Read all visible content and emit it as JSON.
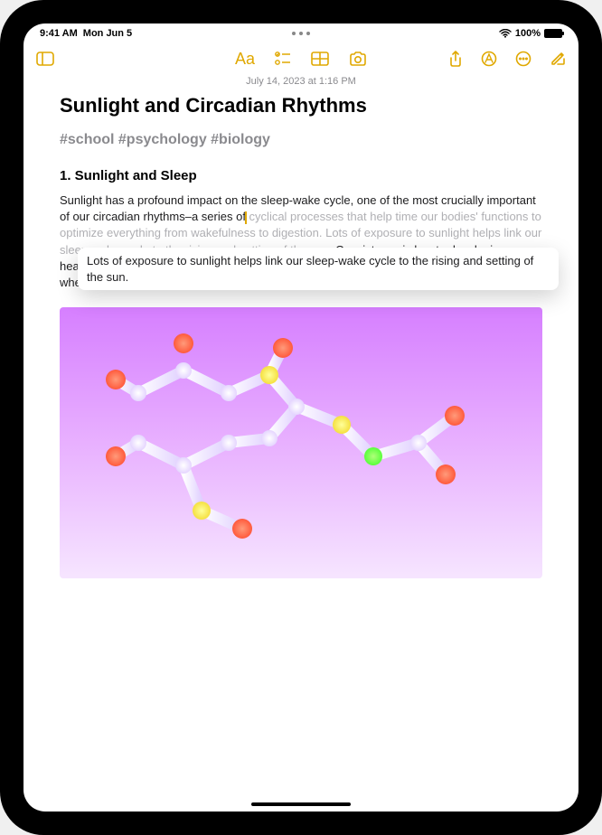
{
  "status": {
    "time": "9:41 AM",
    "date": "Mon Jun 5",
    "battery_pct": "100%"
  },
  "toolbar": {
    "format_label": "Aa"
  },
  "note": {
    "timestamp": "July 14, 2023 at 1:16 PM",
    "title": "Sunlight and Circadian Rhythms",
    "tags": "#school #psychology #biology",
    "section_heading": "1. Sunlight and Sleep",
    "body_before_cursor": "Sunlight has a profound impact on the sleep-wake cycle, one of the most crucially important of our circadian rhythms–a series of",
    "body_dimmed_mid": " cyclical processes that help time our bodies' functions to optimize everything from wakefulness to digestion. Lots of exposure to sunlight helps link our sleep-wake cycle to the rising and setting of the sun. ",
    "body_after": "Consistency is key to developing healthy sleep patterns, and it's easy to slip out of sync in a world of constant connection, where many are used to working across multiple timezones.",
    "drag_text": "Lots of exposure to sunlight helps link our sleep-wake cycle to the rising and setting of the sun."
  },
  "icons": {
    "sidebar": "sidebar-icon",
    "checklist": "checklist-icon",
    "table": "table-icon",
    "camera": "camera-icon",
    "share": "share-icon",
    "markup": "markup-icon",
    "more": "more-icon",
    "compose": "compose-icon",
    "wifi": "wifi-icon",
    "battery": "battery-icon"
  }
}
